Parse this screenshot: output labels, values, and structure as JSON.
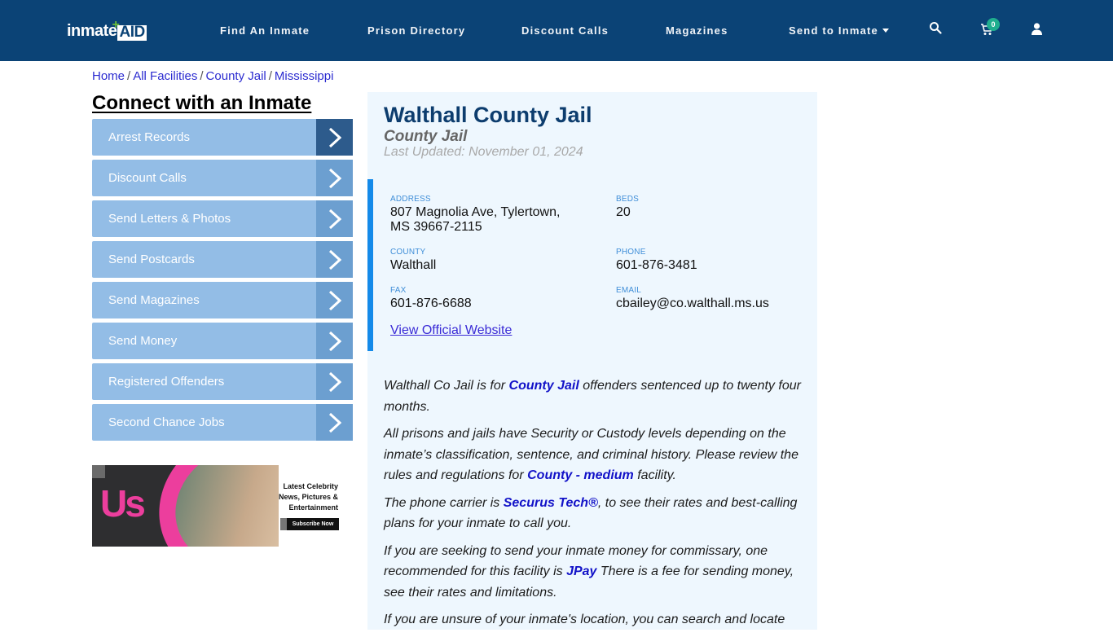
{
  "header": {
    "logo_text": "inmate",
    "logo_accent": "AID",
    "nav": [
      "Find An Inmate",
      "Prison Directory",
      "Discount Calls",
      "Magazines",
      "Send to Inmate"
    ],
    "cart_count": "0",
    "icons": {
      "search": "search-icon",
      "cart": "cart-icon",
      "user": "user-icon"
    }
  },
  "breadcrumb": [
    "Home",
    "All Facilities",
    "County Jail",
    "Mississippi"
  ],
  "sidebar": {
    "title": "Connect with an Inmate",
    "items": [
      "Arrest Records",
      "Discount Calls",
      "Send Letters & Photos",
      "Send Postcards",
      "Send Magazines",
      "Send Money",
      "Registered Offenders",
      "Second Chance Jobs"
    ]
  },
  "ad": {
    "brand": "Us",
    "line1": "Latest Celebrity",
    "line2": "News, Pictures &",
    "line3": "Entertainment",
    "cta": "Subscribe Now"
  },
  "facility": {
    "name": "Walthall County Jail",
    "type": "County Jail",
    "last_updated": "Last Updated: November 01, 2024",
    "fields": {
      "address_label": "ADDRESS",
      "address_line1": "807 Magnolia Ave, Tylertown,",
      "address_line2": "MS 39667-2115",
      "beds_label": "BEDS",
      "beds": "20",
      "county_label": "COUNTY",
      "county": "Walthall",
      "phone_label": "PHONE",
      "phone": "601-876-3481",
      "fax_label": "FAX",
      "fax": "601-876-6688",
      "email_label": "EMAIL",
      "email": "cbailey@co.walthall.ms.us"
    },
    "website_link": "View Official Website"
  },
  "content": {
    "p1_a": "Walthall Co Jail is for ",
    "p1_link": "County Jail",
    "p1_b": " offenders sentenced up to twenty four months.",
    "p2_a": "All prisons and jails have Security or Custody levels depending on the inmate’s classification, sentence, and criminal history. Please review the rules and regulations for ",
    "p2_link": "County - medium",
    "p2_b": " facility.",
    "p3_a": "The phone carrier is ",
    "p3_link": "Securus Tech®",
    "p3_b": ", to see their rates and best-calling plans for your inmate to call you.",
    "p4_a": "If you are seeking to send your inmate money for commissary, one recommended for this facility is ",
    "p4_link": "JPay",
    "p4_b": " There is a fee for sending money, see their rates and limitations.",
    "p5": "If you are unsure of your inmate's location, you can search and locate"
  }
}
